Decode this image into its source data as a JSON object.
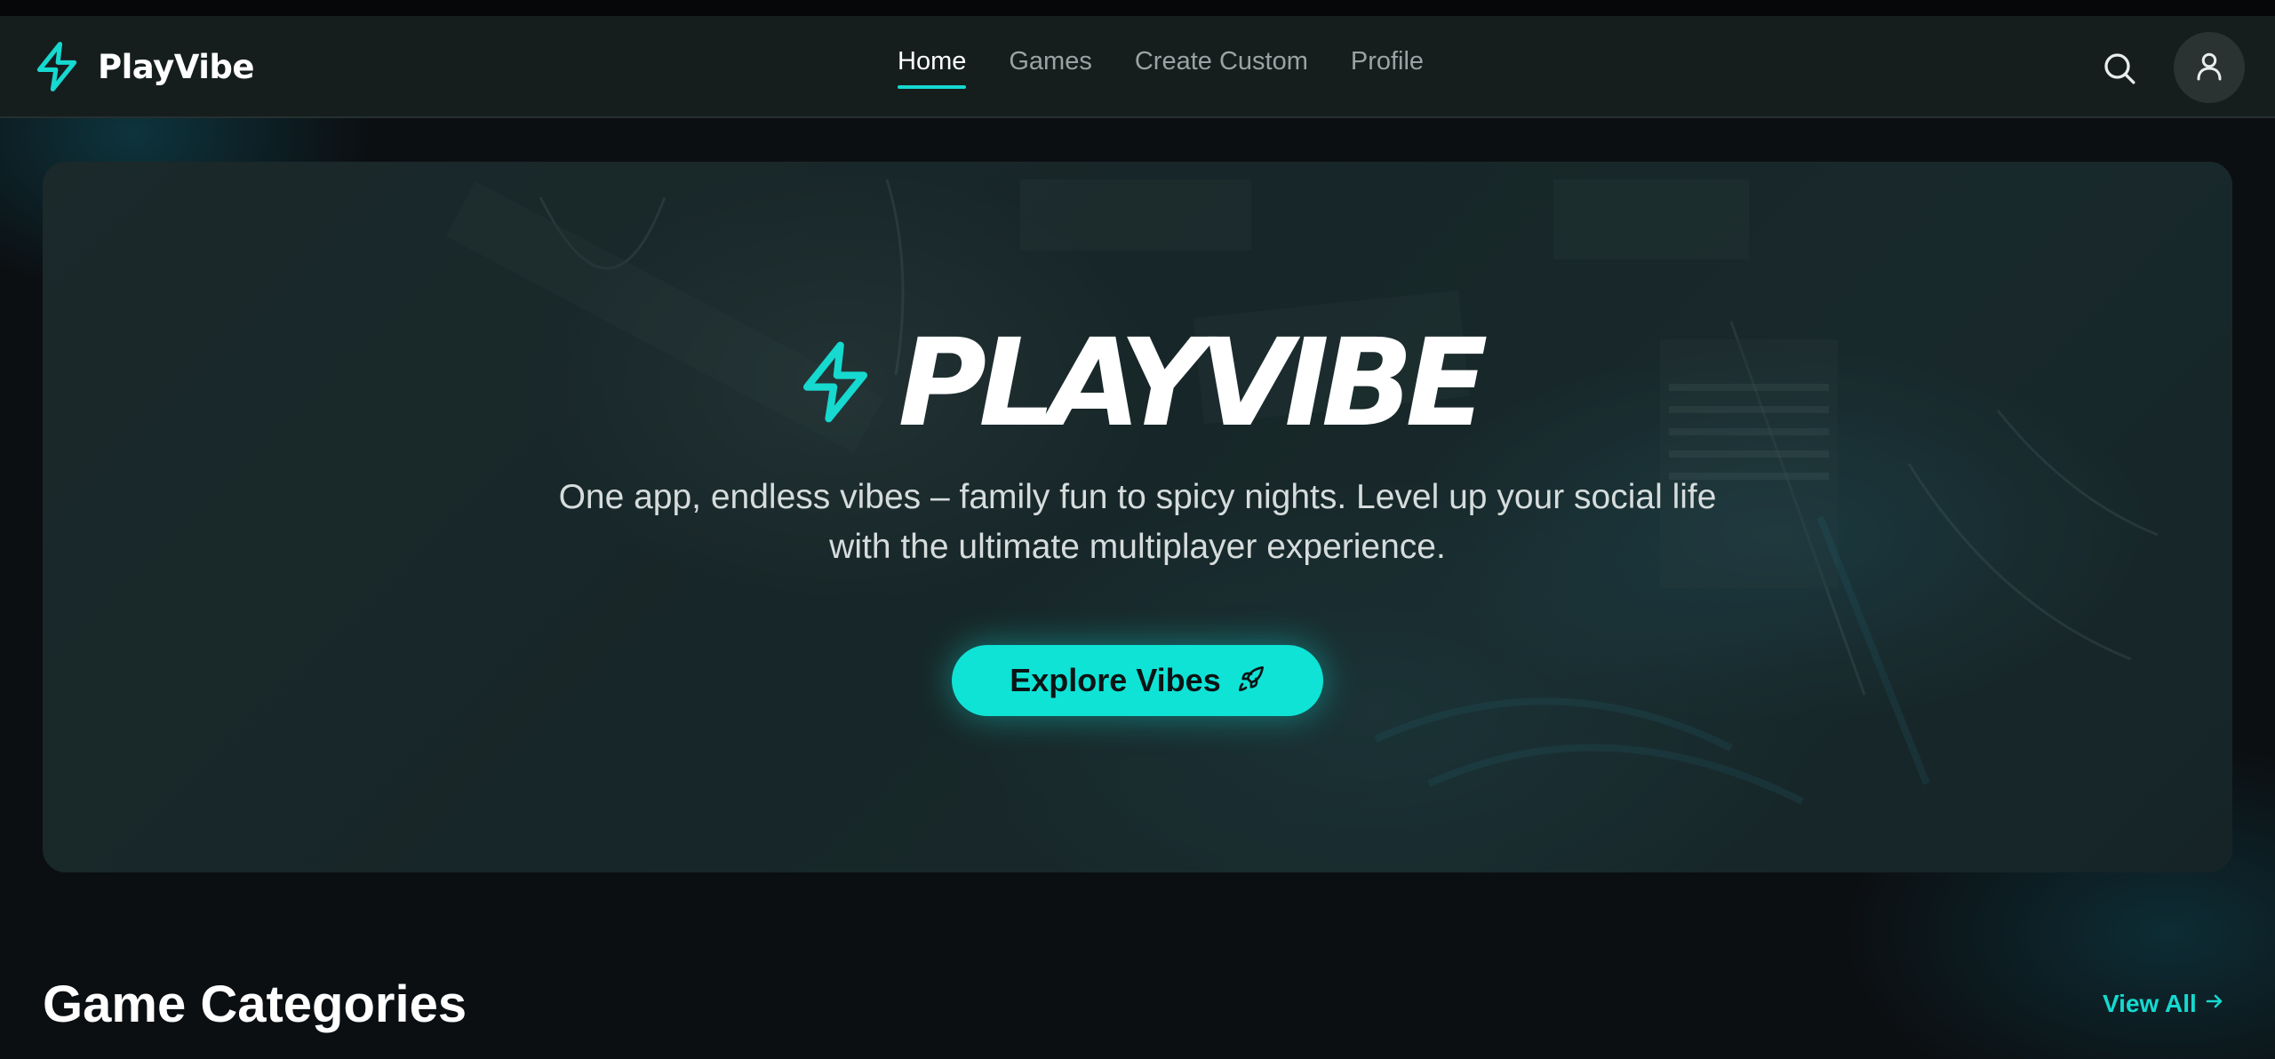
{
  "app": {
    "name": "PlayVibe",
    "logo_icon": "lightning-bolt-icon",
    "accent_color": "#16d9d0"
  },
  "nav": {
    "links": [
      {
        "label": "Home",
        "active": true
      },
      {
        "label": "Games",
        "active": false
      },
      {
        "label": "Create Custom",
        "active": false
      },
      {
        "label": "Profile",
        "active": false
      }
    ],
    "search_icon": "search-icon",
    "avatar_icon": "user-icon"
  },
  "hero": {
    "wordmark": "PLAYVIBE",
    "tagline": "One app, endless vibes – family fun to spicy nights. Level up your social life with the ultimate multiplayer experience.",
    "cta_label": "Explore Vibes",
    "cta_icon": "rocket-icon",
    "cta_color": "#0fe3d6"
  },
  "categories": {
    "title": "Game Categories",
    "view_all_label": "View All",
    "view_all_icon": "arrow-right-icon"
  }
}
